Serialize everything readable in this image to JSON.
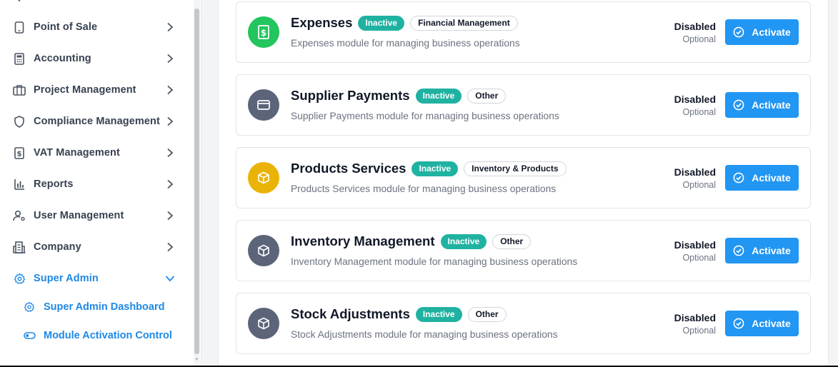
{
  "sidebar": {
    "items": [
      {
        "label": "Point of Sale",
        "icon": "tablet-icon"
      },
      {
        "label": "Accounting",
        "icon": "calculator-icon"
      },
      {
        "label": "Project Management",
        "icon": "briefcase-icon"
      },
      {
        "label": "Compliance Management",
        "icon": "shield-icon"
      },
      {
        "label": "VAT Management",
        "icon": "dollar-receipt-icon"
      },
      {
        "label": "Reports",
        "icon": "bar-chart-icon"
      },
      {
        "label": "User Management",
        "icon": "user-settings-icon"
      },
      {
        "label": "Company",
        "icon": "building-icon"
      },
      {
        "label": "Super Admin",
        "icon": "gear-icon"
      }
    ],
    "subitems": [
      {
        "label": "Super Admin Dashboard",
        "icon": "gear-icon"
      },
      {
        "label": "Module Activation Control",
        "icon": "toggle-icon"
      }
    ],
    "accent_color": "#1e88e5"
  },
  "modules": [
    {
      "title": "Expenses",
      "status": "Inactive",
      "category": "Financial Management",
      "description": "Expenses module for managing business operations",
      "state": "Disabled",
      "requirement": "Optional",
      "action": "Activate",
      "icon": "dollar-icon",
      "icon_color": "#22c55e"
    },
    {
      "title": "Supplier Payments",
      "status": "Inactive",
      "category": "Other",
      "description": "Supplier Payments module for managing business operations",
      "state": "Disabled",
      "requirement": "Optional",
      "action": "Activate",
      "icon": "credit-card-icon",
      "icon_color": "#5b6478"
    },
    {
      "title": "Products Services",
      "status": "Inactive",
      "category": "Inventory & Products",
      "description": "Products Services module for managing business operations",
      "state": "Disabled",
      "requirement": "Optional",
      "action": "Activate",
      "icon": "box-icon",
      "icon_color": "#eab308"
    },
    {
      "title": "Inventory Management",
      "status": "Inactive",
      "category": "Other",
      "description": "Inventory Management module for managing business operations",
      "state": "Disabled",
      "requirement": "Optional",
      "action": "Activate",
      "icon": "box-icon",
      "icon_color": "#5b6478"
    },
    {
      "title": "Stock Adjustments",
      "status": "Inactive",
      "category": "Other",
      "description": "Stock Adjustments module for managing business operations",
      "state": "Disabled",
      "requirement": "Optional",
      "action": "Activate",
      "icon": "box-icon",
      "icon_color": "#5b6478"
    }
  ],
  "colors": {
    "status_badge": "#20b2a1",
    "activate_button": "#2196f3"
  }
}
